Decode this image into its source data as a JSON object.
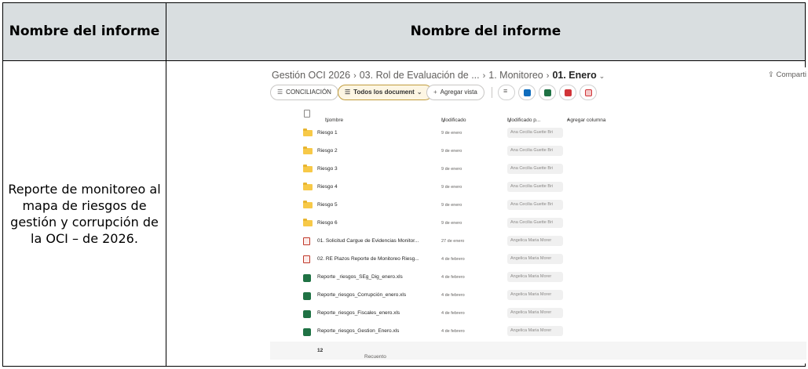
{
  "table": {
    "header_left": "Nombre del informe",
    "header_right": "Nombre del informe",
    "report_name": "Reporte de monitoreo al mapa de riesgos de gestión y corrupción de la OCI – de 2026."
  },
  "sharepoint": {
    "breadcrumb": [
      "Gestión OCI 2026",
      "03. Rol de Evaluación de ...",
      "1. Monitoreo",
      "01. Enero"
    ],
    "share_label": "Comparti",
    "toolbar": {
      "view1": "CONCILIACIÓN",
      "view2": "Todos los document",
      "add_view": "Agregar vista"
    },
    "columns": {
      "name": "Nombre",
      "modified": "Modificado",
      "modified_by": "Modificado p...",
      "add_column": "Agregar columna"
    },
    "rows": [
      {
        "type": "folder",
        "name": "Riesgo 1",
        "date": "9 de enero",
        "by": "Ana Cecilia Guette Bri"
      },
      {
        "type": "folder",
        "name": "Riesgo 2",
        "date": "9 de enero",
        "by": "Ana Cecilia Guette Bri"
      },
      {
        "type": "folder",
        "name": "Riesgo 3",
        "date": "9 de enero",
        "by": "Ana Cecilia Guette Bri"
      },
      {
        "type": "folder",
        "name": "Riesgo 4",
        "date": "9 de enero",
        "by": "Ana Cecilia Guette Bri"
      },
      {
        "type": "folder",
        "name": "Riesgo 5",
        "date": "9 de enero",
        "by": "Ana Cecilia Guette Bri"
      },
      {
        "type": "folder",
        "name": "Riesgo 6",
        "date": "9 de enero",
        "by": "Ana Cecilia Guette Bri"
      },
      {
        "type": "msg",
        "name": "01. Solicitud Cargue de Evidencias Monitor...",
        "date": "27 de enero",
        "by": "Angelica Maria Morer"
      },
      {
        "type": "msg",
        "name": "02. RE Plazos Reporte de Monitoreo Riesg...",
        "date": "4 de febrero",
        "by": "Angelica Maria Morer"
      },
      {
        "type": "xls",
        "name": "Reporte _riesgos_SEg_Dig_enero.xls",
        "date": "4 de febrero",
        "by": "Angelica Maria Morer"
      },
      {
        "type": "xls",
        "name": "Reporte_riesgos_Corrupción_enero.xls",
        "date": "4 de febrero",
        "by": "Angelica Maria Morer"
      },
      {
        "type": "xls",
        "name": "Reporte_riesgos_Fiscales_enero.xls",
        "date": "4 de febrero",
        "by": "Angelica Maria Morer"
      },
      {
        "type": "xls",
        "name": "Reporte_riesgos_Gestion_Enero.xls",
        "date": "4 de febrero",
        "by": "Angelica Maria Morer"
      }
    ],
    "footer_label": "Recuento",
    "footer_count": "12"
  }
}
